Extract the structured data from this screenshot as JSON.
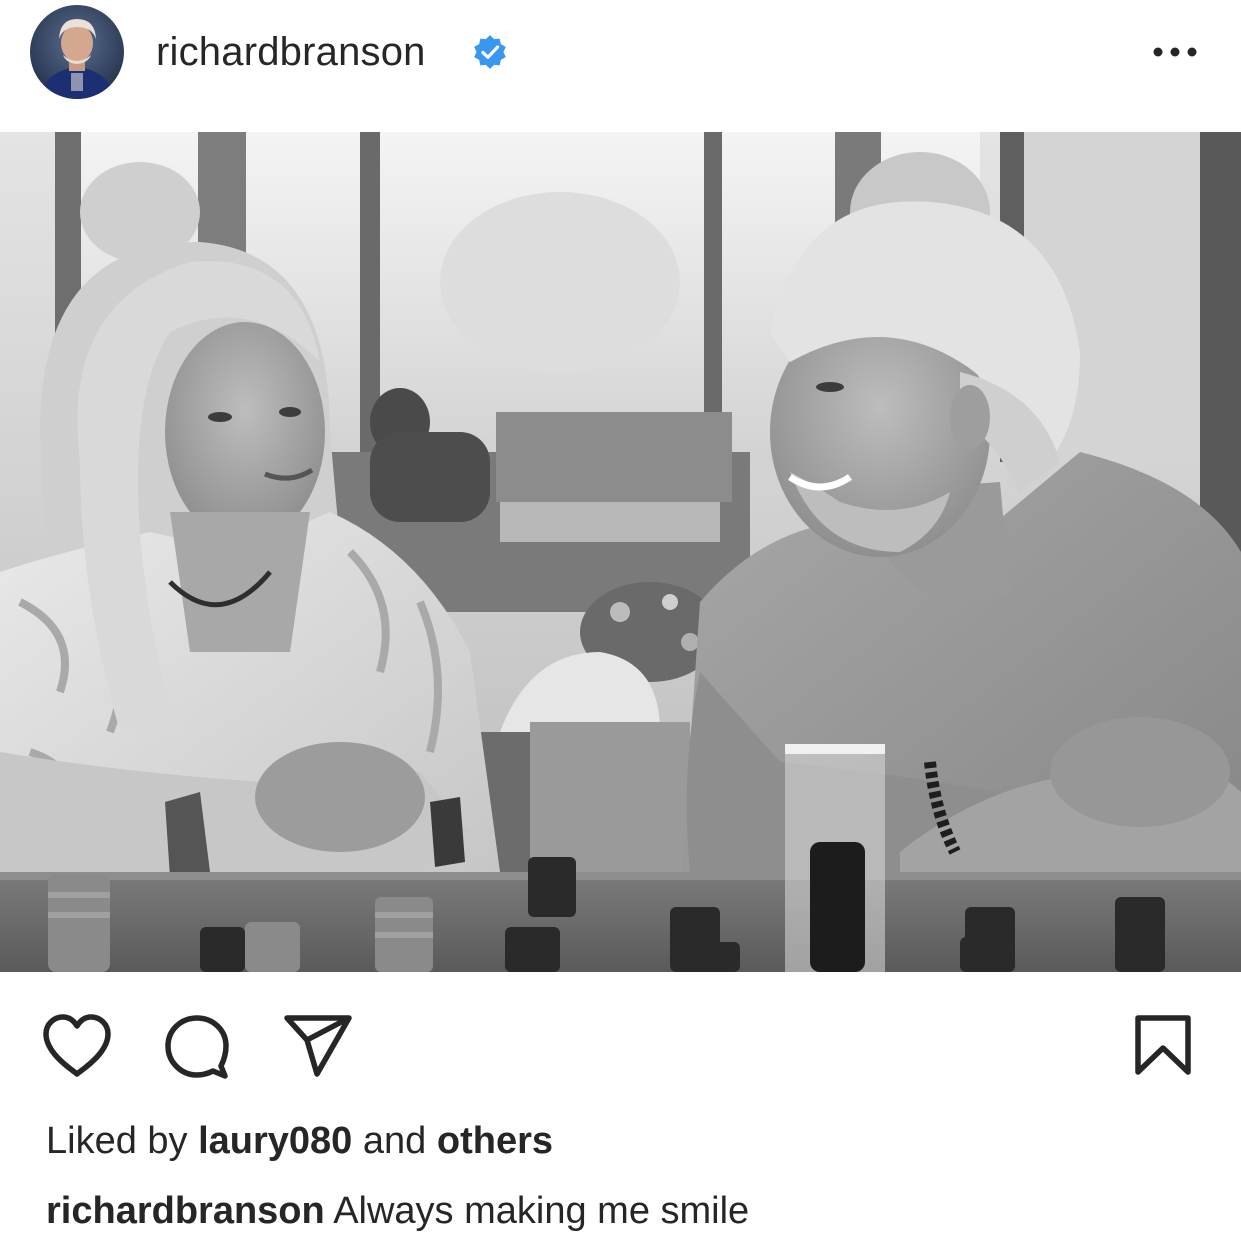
{
  "post": {
    "username": "richardbranson",
    "verified_icon": "verified-badge-icon",
    "more_icon": "more-options-icon",
    "photo_alt": "",
    "actions": {
      "like_icon": "heart-icon",
      "comment_icon": "comment-icon",
      "share_icon": "paper-plane-icon",
      "save_icon": "bookmark-icon"
    },
    "likes": {
      "prefix": "Liked by ",
      "user": "laury080",
      "middle": " and ",
      "others": "others"
    },
    "caption": {
      "username": "richardbranson",
      "text": " Always making me smile"
    }
  },
  "colors": {
    "text": "#262626",
    "verified": "#3897f0",
    "background": "#ffffff"
  }
}
